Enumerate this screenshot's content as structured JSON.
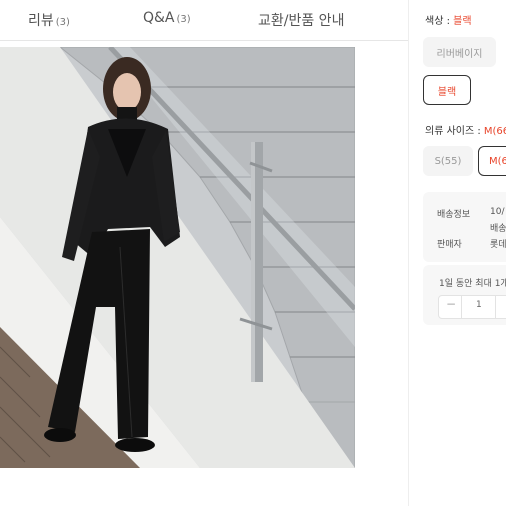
{
  "tabs": [
    {
      "label": "리뷰",
      "count": "(3)"
    },
    {
      "label": "Q&A",
      "count": "(3)"
    },
    {
      "label": "교환/반품 안내",
      "count": ""
    }
  ],
  "color": {
    "label": "색상 : ",
    "selected": "블랙",
    "options": [
      "리버베이지",
      "블랙"
    ]
  },
  "size": {
    "label": "의류 사이즈 : ",
    "selected": "M(66",
    "options": [
      "S(55)",
      "M(6"
    ]
  },
  "info": {
    "shipping_label": "배송정보",
    "shipping_value_1": "10/",
    "shipping_value_2": "배송",
    "seller_label": "판매자",
    "seller_value": "롯데"
  },
  "purchase": {
    "limit_text": "1일 동안 최대 1개 구",
    "quantity": "1",
    "minus": "−"
  },
  "colors": {
    "accent": "#e8442a",
    "selected_border": "#333333"
  }
}
